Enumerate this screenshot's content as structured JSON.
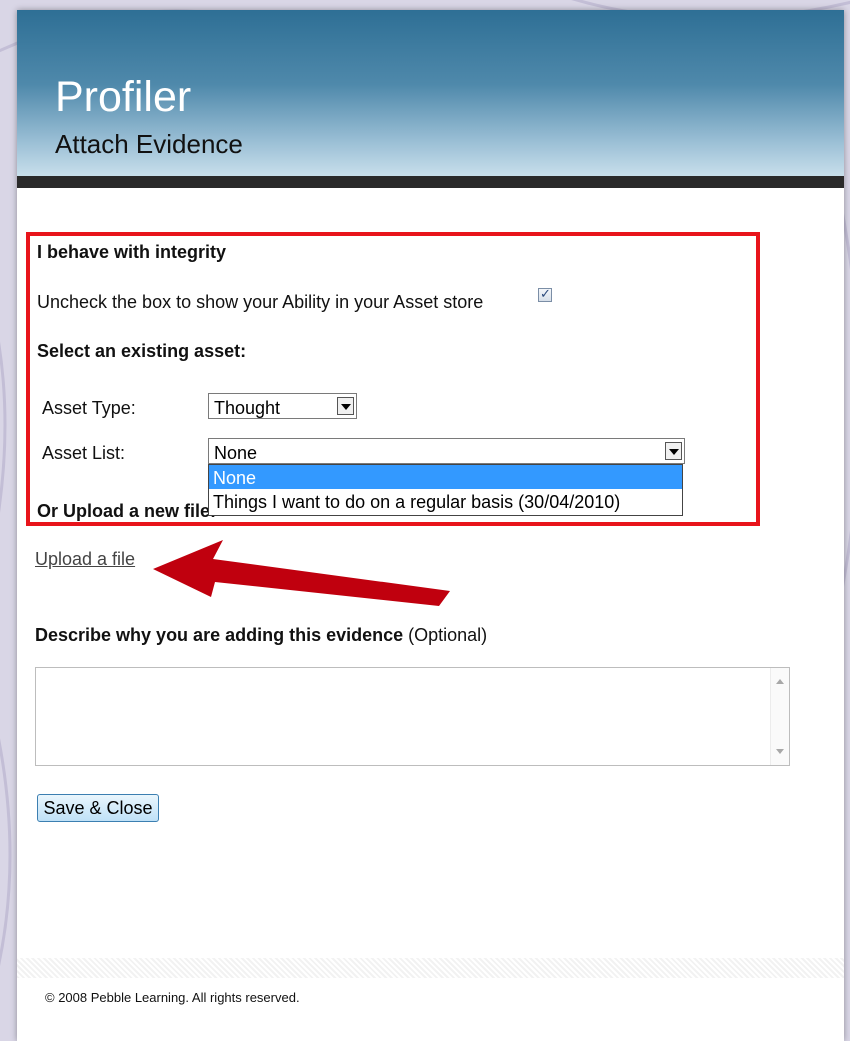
{
  "header": {
    "app_title": "Profiler",
    "subtitle": "Attach Evidence"
  },
  "ability": {
    "title": "I behave with integrity",
    "uncheck_label": "Uncheck the box to show your Ability in your Asset store",
    "checked": true,
    "check_glyph": "✓"
  },
  "existing_asset": {
    "heading": "Select an existing asset:",
    "asset_type_label": "Asset Type:",
    "asset_type_value": "Thought",
    "asset_list_label": "Asset List:",
    "asset_list_value": "None",
    "asset_list_options": [
      "None",
      "Things I want to do on a regular basis (30/04/2010)"
    ]
  },
  "upload": {
    "heading": "Or Upload a new file:",
    "link": "Upload a file"
  },
  "describe": {
    "label": "Describe why you are adding this evidence",
    "optional": "(Optional)",
    "value": ""
  },
  "actions": {
    "save_close": "Save & Close"
  },
  "footer": {
    "copyright": "© 2008 Pebble Learning. All rights reserved."
  },
  "colors": {
    "highlight": "#e8141b",
    "arrow": "#c0000e",
    "header_top": "#2e6f95",
    "selected_option": "#3399ff"
  }
}
